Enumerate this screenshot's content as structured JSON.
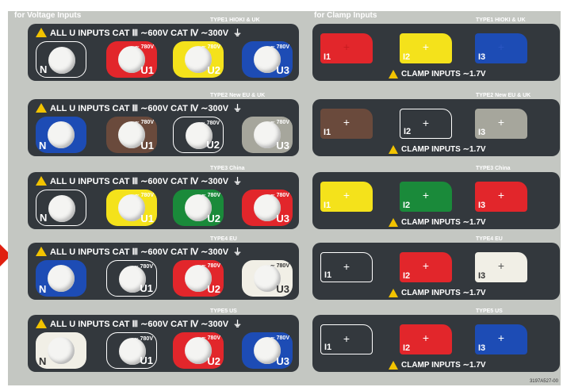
{
  "voltage_title": "for Voltage Inputs",
  "clamp_title": "for Clamp Inputs",
  "header_text": "ALL U INPUTS  CAT Ⅲ ∼600V  CAT Ⅳ ∼300V",
  "ground_symbol": "⏚",
  "rating_mark": "∼ 780V",
  "clamp_footer": "CLAMP INPUTS  ∼1.7V",
  "plus": "+",
  "part_number": "3197A527-00",
  "colors": {
    "red": "#e2262b",
    "yellow": "#f4e21b",
    "blue": "#1d4cb5",
    "brown": "#6a4a3c",
    "gray": "#a6a69c",
    "green": "#1a8a3a",
    "white": "#f1efe6",
    "black": "#2d3136"
  },
  "types": [
    {
      "label": "TYPE1 HIOKI & UK",
      "voltage": [
        {
          "name": "N",
          "color": "black",
          "outline": true
        },
        {
          "name": "U1",
          "color": "red"
        },
        {
          "name": "U2",
          "color": "yellow"
        },
        {
          "name": "U3",
          "color": "blue"
        }
      ],
      "clamp": [
        {
          "name": "I1",
          "color": "red"
        },
        {
          "name": "I2",
          "color": "yellow"
        },
        {
          "name": "I3",
          "color": "blue"
        }
      ]
    },
    {
      "label": "TYPE2 New EU & UK",
      "voltage": [
        {
          "name": "N",
          "color": "blue"
        },
        {
          "name": "U1",
          "color": "brown"
        },
        {
          "name": "U2",
          "color": "black",
          "outline": true
        },
        {
          "name": "U3",
          "color": "gray"
        }
      ],
      "clamp": [
        {
          "name": "I1",
          "color": "brown"
        },
        {
          "name": "I2",
          "color": "black",
          "outline": true
        },
        {
          "name": "I3",
          "color": "gray"
        }
      ]
    },
    {
      "label": "TYPE3 China",
      "voltage": [
        {
          "name": "N",
          "color": "black",
          "outline": true
        },
        {
          "name": "U1",
          "color": "yellow"
        },
        {
          "name": "U2",
          "color": "green"
        },
        {
          "name": "U3",
          "color": "red"
        }
      ],
      "clamp": [
        {
          "name": "I1",
          "color": "yellow"
        },
        {
          "name": "I2",
          "color": "green"
        },
        {
          "name": "I3",
          "color": "red"
        }
      ]
    },
    {
      "label": "TYPE4 EU",
      "voltage": [
        {
          "name": "N",
          "color": "blue"
        },
        {
          "name": "U1",
          "color": "black",
          "outline": true
        },
        {
          "name": "U2",
          "color": "red"
        },
        {
          "name": "U3",
          "color": "white"
        }
      ],
      "clamp": [
        {
          "name": "I1",
          "color": "black",
          "outline": true
        },
        {
          "name": "I2",
          "color": "red"
        },
        {
          "name": "I3",
          "color": "white"
        }
      ]
    },
    {
      "label": "TYPE5 US",
      "voltage": [
        {
          "name": "N",
          "color": "white"
        },
        {
          "name": "U1",
          "color": "black",
          "outline": true
        },
        {
          "name": "U2",
          "color": "red"
        },
        {
          "name": "U3",
          "color": "blue"
        }
      ],
      "clamp": [
        {
          "name": "I1",
          "color": "black",
          "outline": true
        },
        {
          "name": "I2",
          "color": "red"
        },
        {
          "name": "I3",
          "color": "blue"
        }
      ]
    }
  ]
}
